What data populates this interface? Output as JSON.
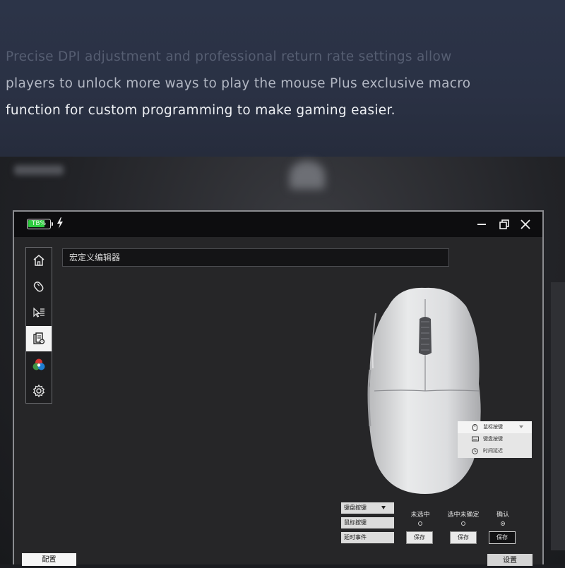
{
  "banner": {
    "line1": "Precise DPI adjustment and professional return rate settings allow",
    "line2": "players to unlock more ways to play the mouse Plus exclusive macro",
    "line3": "function for custom programming to make gaming easier."
  },
  "titlebar": {
    "battery_label": "TB%",
    "battery_level_percent": 80,
    "charging_icon": "lightning-bolt-icon",
    "minimize_icon": "minimize-icon",
    "restore_icon": "restore-icon",
    "close_icon": "close-icon"
  },
  "sidebar": {
    "items": [
      {
        "icon": "home-icon",
        "active": false
      },
      {
        "icon": "mouse-outline-icon",
        "active": false
      },
      {
        "icon": "cursor-list-icon",
        "active": false
      },
      {
        "icon": "macro-document-icon",
        "active": true
      },
      {
        "icon": "rgb-color-icon",
        "active": false
      },
      {
        "icon": "gear-icon",
        "active": false
      }
    ]
  },
  "editor": {
    "title": "宏定义编辑器"
  },
  "key_menu": {
    "items": [
      "鼠标按键",
      "键盘按键",
      "时间延迟"
    ],
    "selected": "鼠标按键"
  },
  "event_panel": {
    "dropdown_value": "键盘按键",
    "options": [
      "鼠标按键",
      "延时事件"
    ]
  },
  "state_columns": [
    {
      "label": "未选中",
      "radio_checked": false,
      "save_label": "保存"
    },
    {
      "label": "选中未确定",
      "radio_checked": false,
      "save_label": "保存"
    },
    {
      "label": "确认",
      "radio_checked": true,
      "save_label": "保存"
    }
  ],
  "bottom_tabs": {
    "config_label": "配置",
    "settings_label": "设置"
  },
  "colors": {
    "banner_bg": "#2c3448",
    "window_bg": "#262628",
    "titlebar_bg": "#0d0d0f",
    "battery_green": "#2ecc40",
    "accent_white": "#f4f4f4"
  }
}
